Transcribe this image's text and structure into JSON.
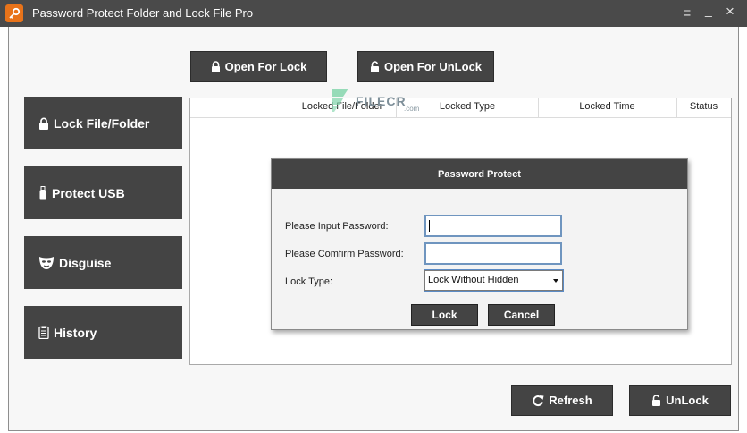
{
  "window": {
    "title": "Password Protect Folder and Lock File Pro",
    "controls": {
      "menu": "≡",
      "minimize": "_",
      "close": "×"
    }
  },
  "toolbar": {
    "open_for_lock": "Open For Lock",
    "open_for_unlock": "Open For UnLock"
  },
  "sidebar": {
    "items": [
      {
        "label": "Lock File/Folder",
        "icon": "lock-icon"
      },
      {
        "label": "Protect USB",
        "icon": "usb-icon"
      },
      {
        "label": "Disguise",
        "icon": "mask-icon"
      },
      {
        "label": "History",
        "icon": "clipboard-icon"
      }
    ]
  },
  "table": {
    "columns": [
      "Locked File/Folder",
      "Locked Type",
      "Locked Time",
      "Status"
    ],
    "rows": []
  },
  "watermark": {
    "text": "FILECR",
    "sub": ".com"
  },
  "dialog": {
    "title": "Password Protect",
    "password_label": "Please Input Password:",
    "password_value": "",
    "confirm_label": "Please Comfirm Password:",
    "confirm_value": "",
    "lock_type_label": "Lock Type:",
    "lock_type_value": "Lock Without Hidden",
    "lock_button": "Lock",
    "cancel_button": "Cancel"
  },
  "bottom": {
    "refresh": "Refresh",
    "unlock": "UnLock"
  },
  "colors": {
    "titlebar": "#4a4a4a",
    "button_dark": "#444444",
    "app_icon": "#e8731a",
    "input_border": "#6f95bf"
  }
}
